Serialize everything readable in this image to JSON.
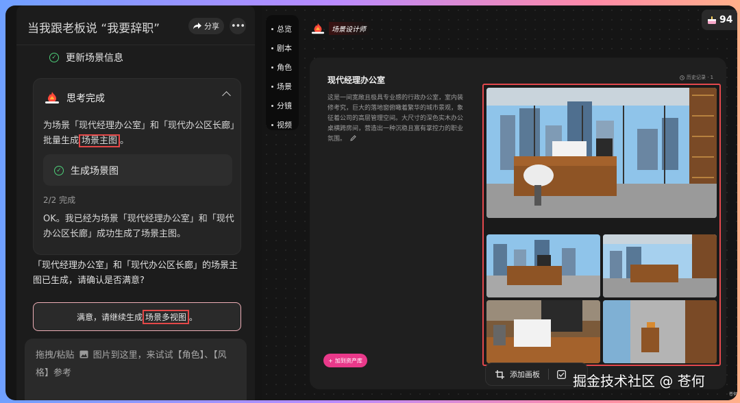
{
  "chat": {
    "title": "当我跟老板说 “我要辞职”",
    "share_label": "分享",
    "more_label": "•••",
    "update_item": "更新场景信息",
    "think_title": "思考完成",
    "think_text_pre": "为场景「现代经理办公室」和「现代办公区长廊」批量生成",
    "think_text_hl": "场景主图",
    "think_text_post": "。",
    "gen_item": "生成场景图",
    "progress": "2/2 完成",
    "ok_text": "OK。我已经为场景「现代经理办公室」和「现代办公区长廊」成功生成了场景主图。",
    "confirm_text": "「现代经理办公室」和「现代办公区长廊」的场景主图已生成，请确认是否满意?",
    "cta_pre": "满意，请继续生成",
    "cta_hl": "场景多视图",
    "cta_post": "。",
    "input_placeholder_1": "拖拽/粘贴",
    "input_placeholder_2": "图片到这里，来试试【角色】、【风格】参考"
  },
  "nav": {
    "items": [
      "总览",
      "剧本",
      "角色",
      "场景",
      "分镜",
      "视频"
    ]
  },
  "canvas": {
    "scene_tag": "场景设计师",
    "points": "94",
    "scene_title": "现代经理办公室",
    "scene_desc": "这是一间宽敞且极具专业感的行政办公室，室内装修考究，巨大的落地窗俯瞰着繁华的城市景观，象征着公司的高层管理空间。大尺寸的深色实木办公桌横跨房间，营造出一种沉稳且富有掌控力的职业氛围。",
    "history_label": "历史记录 · 1",
    "add_asset_label": "加到资产库",
    "add_board_label": "添加画板",
    "watermark": "掘金技术社区 @ 苍何",
    "tiny_mark": "苍何"
  },
  "colors": {
    "accent_red": "#e5484d",
    "accent_pink": "#e9398a",
    "check_green": "#4ed17a"
  },
  "icons": {
    "share": "share-arrow-icon",
    "check": "check-circle-icon",
    "flame": "flame-icon",
    "chevron": "chevron-up-icon",
    "image": "image-icon",
    "edit": "pencil-icon",
    "plus": "plus-icon",
    "board": "crop-frame-icon",
    "checkbox": "checkbox-icon",
    "points": "cake-icon"
  }
}
